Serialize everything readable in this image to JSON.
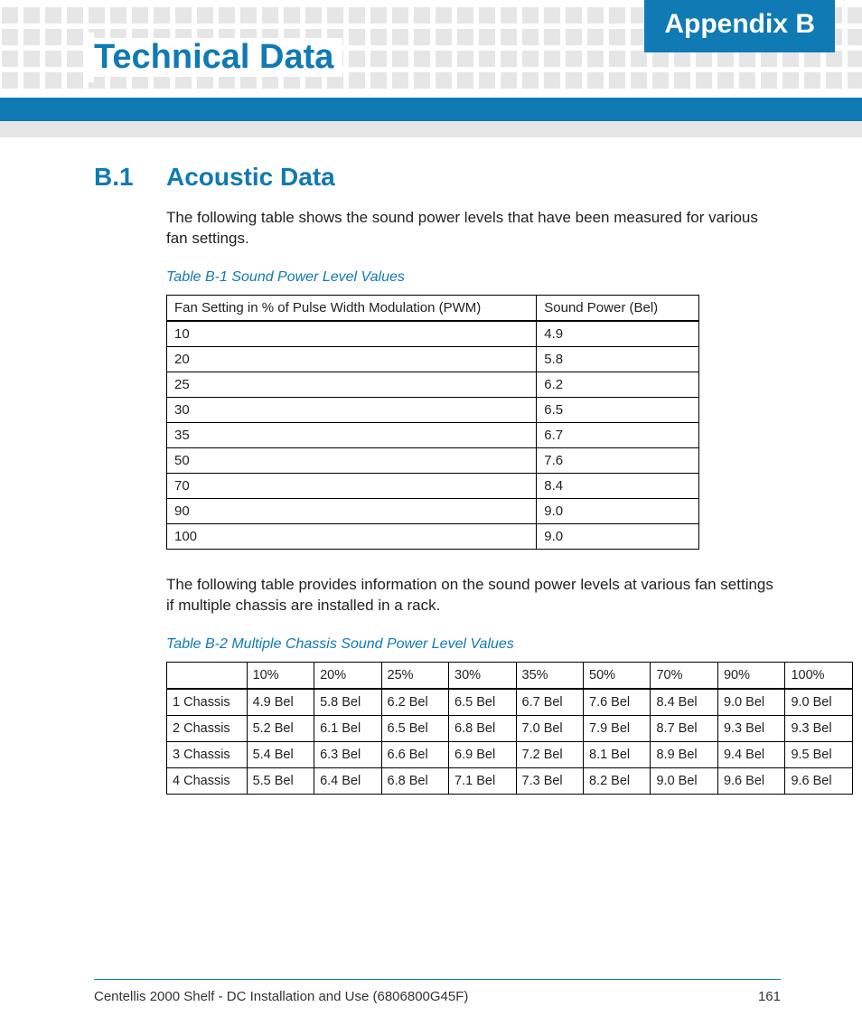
{
  "header": {
    "appendix_tab": "Appendix B",
    "chapter_title": "Technical Data"
  },
  "section": {
    "number": "B.1",
    "title": "Acoustic Data",
    "intro1": "The following table shows the sound power levels that have been measured for various fan settings.",
    "intro2": "The following table provides information on the sound power levels at various fan settings if multiple chassis are installed in a rack."
  },
  "table1": {
    "caption": "Table B-1 Sound Power Level Values",
    "head_col1": "Fan Setting  in % of Pulse Width Modulation (PWM)",
    "head_col2": "Sound Power (Bel)",
    "rows": [
      {
        "c1": "10",
        "c2": "4.9"
      },
      {
        "c1": "20",
        "c2": "5.8"
      },
      {
        "c1": "25",
        "c2": "6.2"
      },
      {
        "c1": "30",
        "c2": "6.5"
      },
      {
        "c1": "35",
        "c2": "6.7"
      },
      {
        "c1": "50",
        "c2": "7.6"
      },
      {
        "c1": "70",
        "c2": "8.4"
      },
      {
        "c1": "90",
        "c2": "9.0"
      },
      {
        "c1": "100",
        "c2": "9.0"
      }
    ]
  },
  "table2": {
    "caption": "Table B-2 Multiple Chassis Sound Power Level Values",
    "head": [
      "",
      "10%",
      "20%",
      "25%",
      "30%",
      "35%",
      "50%",
      "70%",
      "90%",
      "100%"
    ],
    "rows": [
      {
        "label": "1 Chassis",
        "v": [
          "4.9 Bel",
          "5.8 Bel",
          "6.2 Bel",
          "6.5 Bel",
          "6.7 Bel",
          "7.6 Bel",
          "8.4 Bel",
          "9.0 Bel",
          "9.0 Bel"
        ]
      },
      {
        "label": "2 Chassis",
        "v": [
          "5.2 Bel",
          "6.1 Bel",
          "6.5 Bel",
          "6.8 Bel",
          "7.0 Bel",
          "7.9 Bel",
          "8.7 Bel",
          "9.3 Bel",
          "9.3 Bel"
        ]
      },
      {
        "label": "3 Chassis",
        "v": [
          "5.4 Bel",
          "6.3 Bel",
          "6.6 Bel",
          "6.9 Bel",
          "7.2 Bel",
          "8.1 Bel",
          "8.9 Bel",
          "9.4 Bel",
          "9.5 Bel"
        ]
      },
      {
        "label": "4 Chassis",
        "v": [
          "5.5 Bel",
          "6.4 Bel",
          "6.8 Bel",
          "7.1 Bel",
          "7.3 Bel",
          "8.2 Bel",
          "9.0 Bel",
          "9.6 Bel",
          "9.6 Bel"
        ]
      }
    ]
  },
  "footer": {
    "doc": "Centellis 2000 Shelf - DC Installation and Use (6806800G45F)",
    "page": "161"
  }
}
